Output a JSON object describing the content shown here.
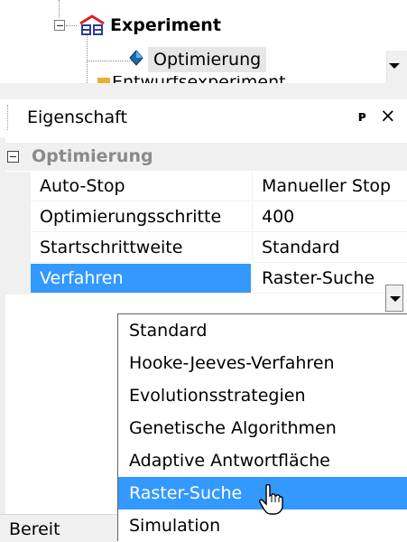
{
  "tree": {
    "experiment_label": "Experiment",
    "optimierung_label": "Optimierung",
    "partial_label": "Entwurfsexperiment"
  },
  "panel": {
    "title": "Eigenschaft",
    "pin_glyph": "ᴩ",
    "close_glyph": "×"
  },
  "grid": {
    "category": "Optimierung",
    "rows": [
      {
        "name": "Auto-Stop",
        "value": "Manueller Stop"
      },
      {
        "name": "Optimierungsschritte",
        "value": "400"
      },
      {
        "name": "Startschrittweite",
        "value": "Standard"
      },
      {
        "name": "Verfahren",
        "value": "Raster-Suche"
      }
    ]
  },
  "dropdown": {
    "options": [
      "Standard",
      "Hooke-Jeeves-Verfahren",
      "Evolutionsstrategien",
      "Genetische Algorithmen",
      "Adaptive Antwortfläche",
      "Raster-Suche",
      "Simulation"
    ],
    "selected": "Raster-Suche"
  },
  "status": {
    "text": "Bereit"
  },
  "colors": {
    "selection": "#3399ff",
    "panel_bg": "#f0f0f0"
  }
}
